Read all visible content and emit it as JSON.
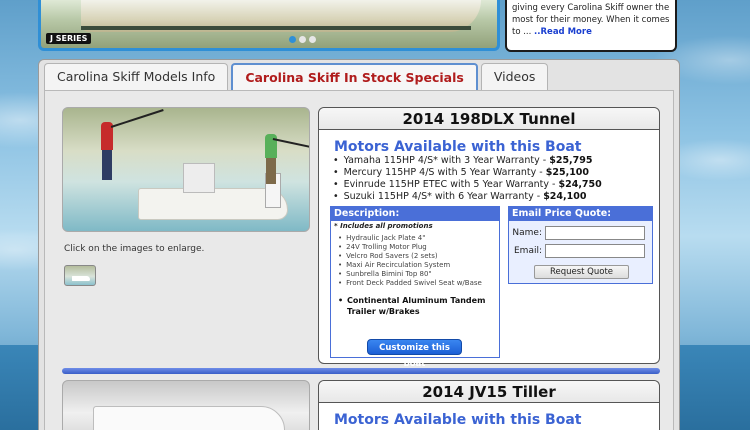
{
  "banner": {
    "series_tag": "J SERIES",
    "teaser_text": "giving every Carolina Skiff owner the most for their money. When it comes to ... ",
    "read_more": "..Read More"
  },
  "tabs": [
    {
      "label": "Carolina Skiff Models Info",
      "active": false
    },
    {
      "label": "Carolina Skiff In Stock Specials",
      "active": true
    },
    {
      "label": "Videos",
      "active": false
    }
  ],
  "listing1": {
    "title": "2014 198DLX Tunnel",
    "enlarge_text": "Click on the images to enlarge.",
    "motors_title": "Motors Available with this Boat",
    "motors": [
      {
        "text": "Yamaha 115HP 4/S* with 3 Year Warranty - ",
        "price": "$25,795"
      },
      {
        "text": "Mercury 115HP 4/S with 5 Year Warranty - ",
        "price": "$25,100"
      },
      {
        "text": "Evinrude 115HP ETEC with 5 Year Warranty - ",
        "price": "$24,750"
      },
      {
        "text": "Suzuki 115HP 4/S* with 6 Year Warranty - ",
        "price": "$24,100"
      }
    ],
    "description_title": "Description:",
    "includes_note": "* Includes all promotions",
    "promotions": [
      "Hydraulic Jack Plate 4\"",
      "24V Trolling Motor Plug",
      "Velcro Rod Savers (2 sets)",
      "Maxi Air Recirculation System",
      "Sunbrella Bimini Top 80\"",
      "Front Deck Padded Swivel Seat w/Base"
    ],
    "trailer": "Continental Aluminum Tandem Trailer w/Brakes",
    "customize_label": "Customize this boat",
    "quote_title": "Email Price Quote:",
    "name_label": "Name:",
    "email_label": "Email:",
    "quote_button": "Request Quote"
  },
  "listing2": {
    "title": "2014 JV15 Tiller",
    "motors_title": "Motors Available with this Boat"
  }
}
